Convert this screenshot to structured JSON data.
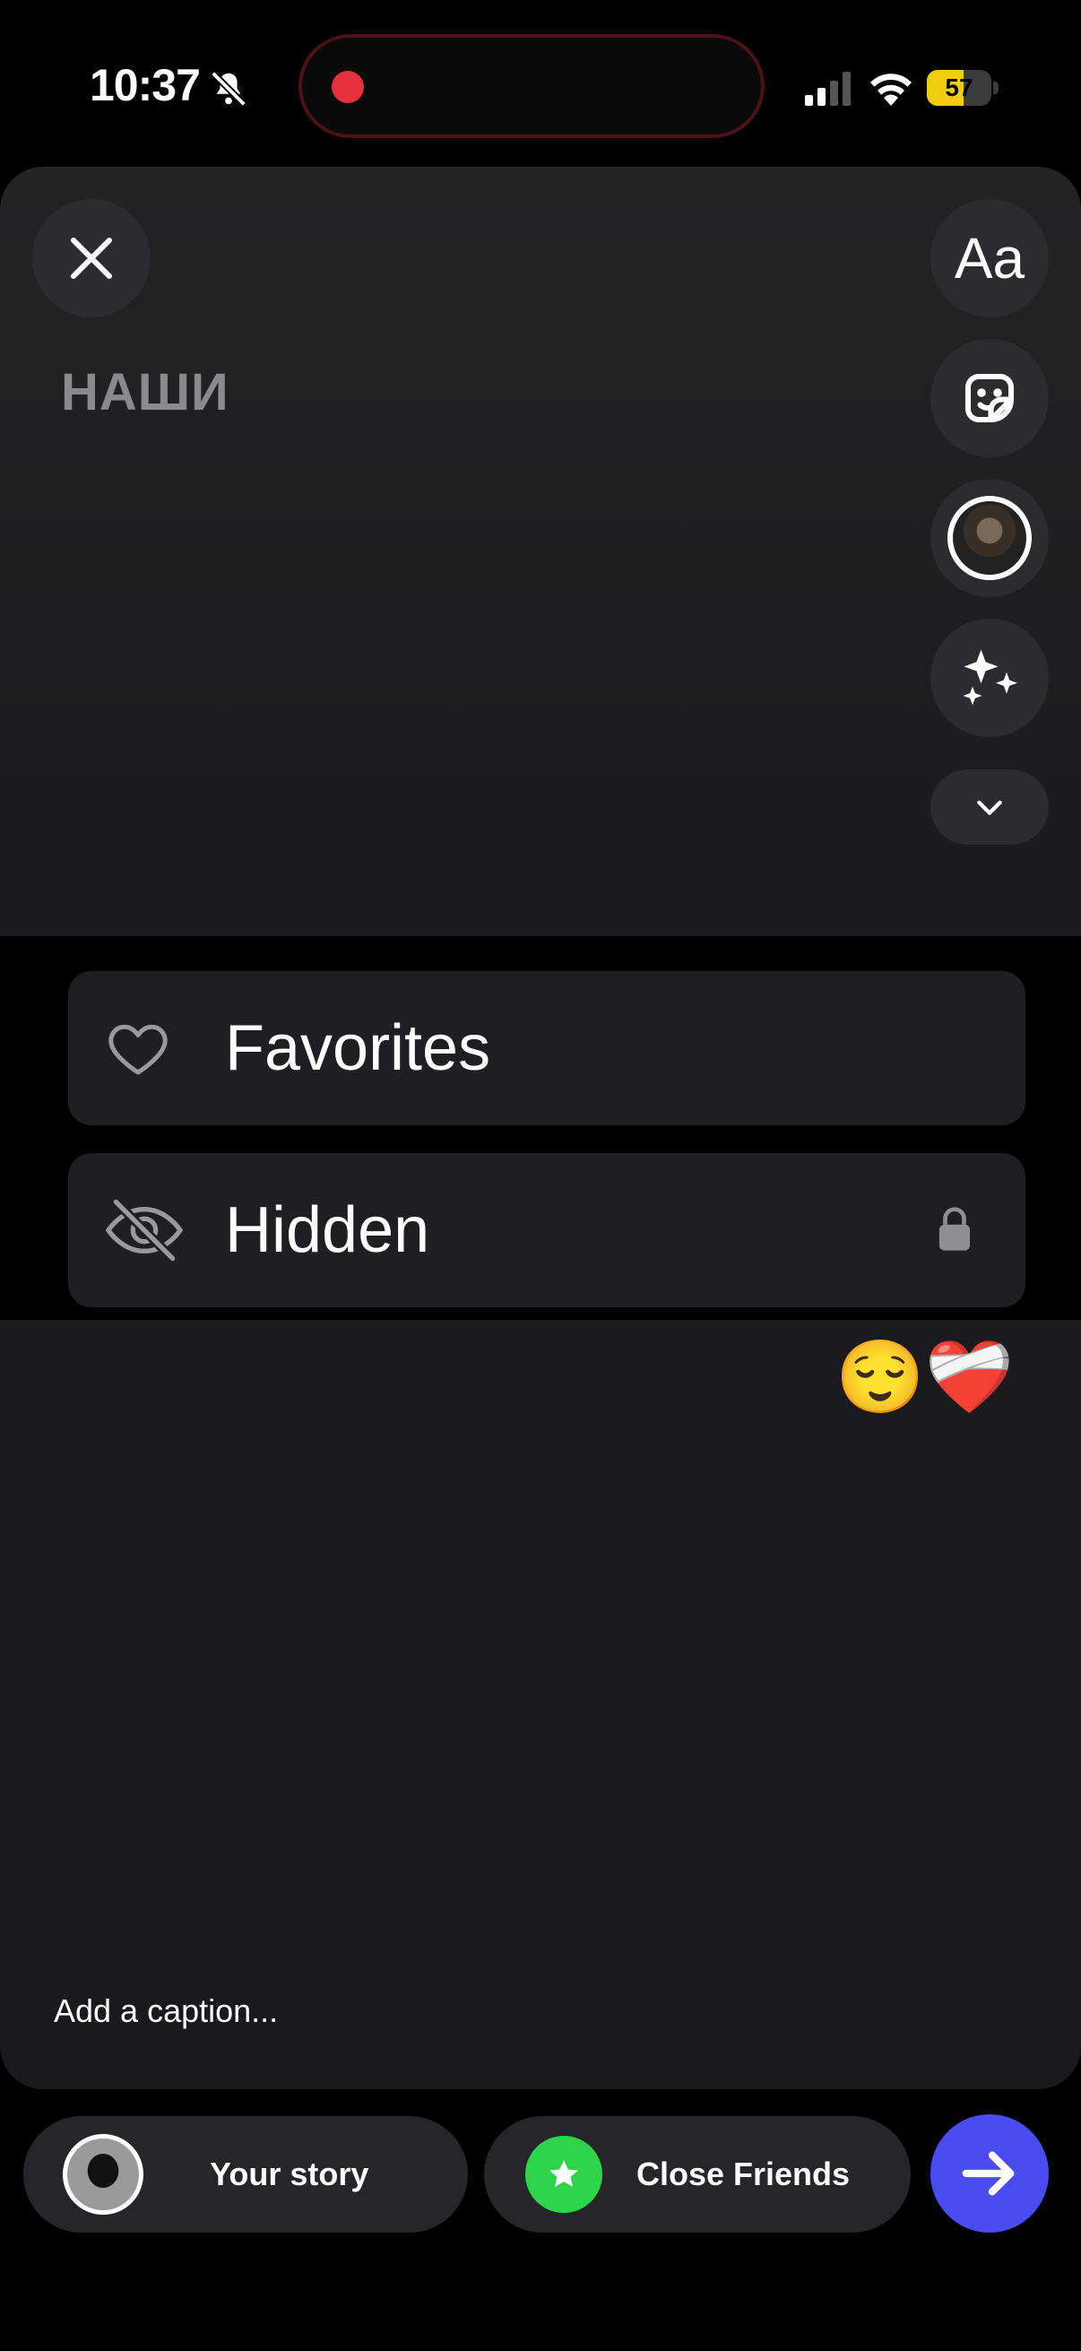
{
  "status_bar": {
    "time": "10:37",
    "battery_level": "57",
    "battery_fraction": 0.57,
    "accent_recording": "#e5323e",
    "battery_color": "#f2cc0f"
  },
  "editor": {
    "text_tool_label": "Aa",
    "overlay_text": "НАШИ",
    "emoji_sticker": "😌❤️‍🩹",
    "caption_placeholder": "Add a caption..."
  },
  "album_picker": {
    "items": [
      {
        "label": "Favorites",
        "icon": "heart-icon"
      },
      {
        "label": "Hidden",
        "icon": "eye-slash-icon",
        "locked": true
      }
    ]
  },
  "share_bar": {
    "your_story_label": "Your story",
    "close_friends_label": "Close Friends",
    "close_friends_color": "#2fd44a",
    "send_color": "#4a4cf0"
  }
}
